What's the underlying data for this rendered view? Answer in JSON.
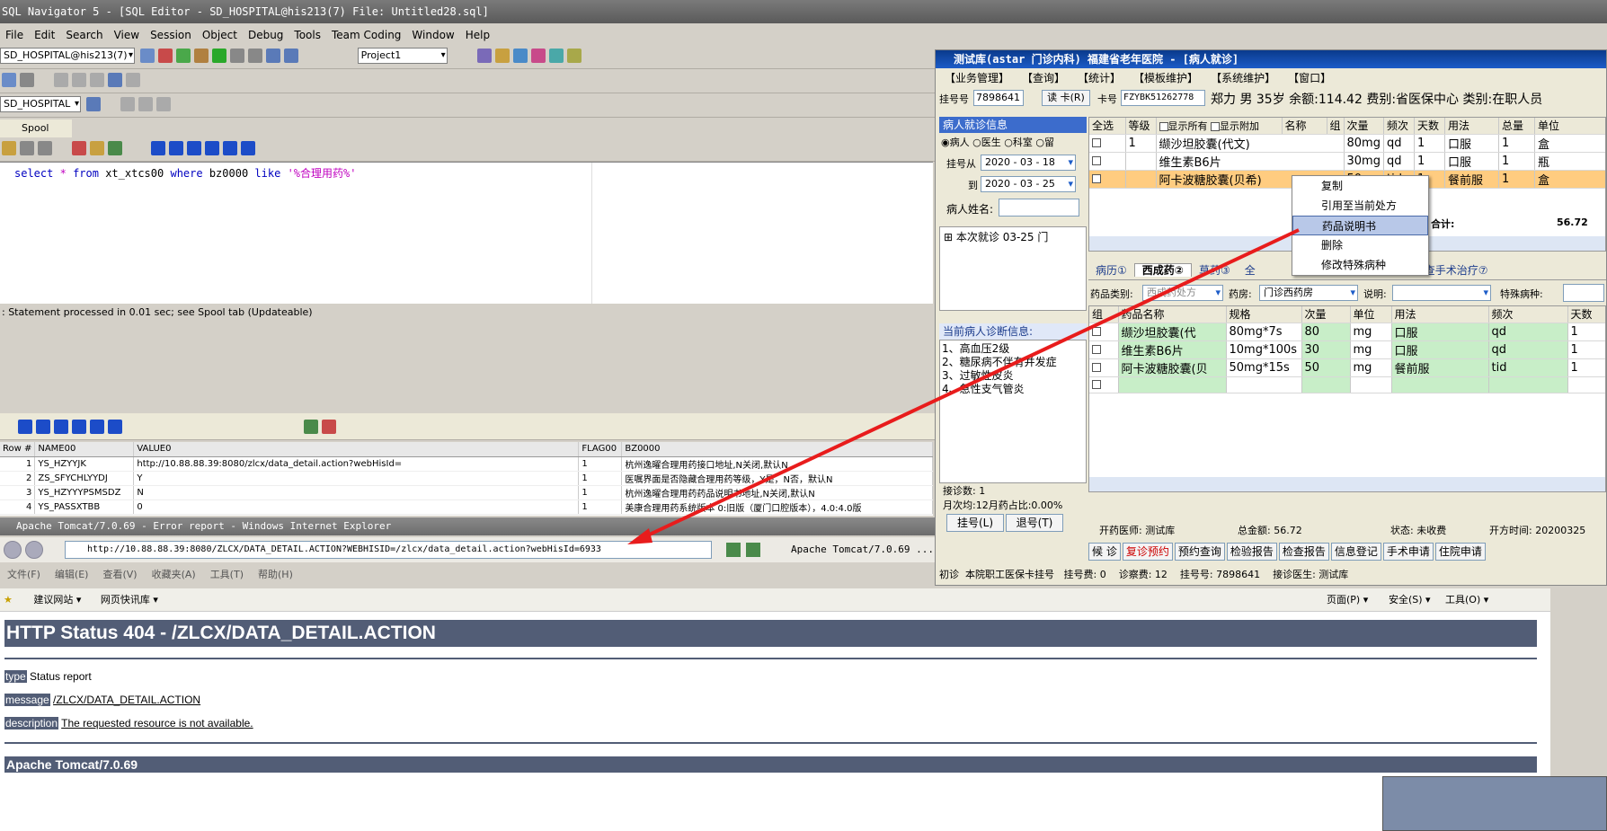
{
  "app": {
    "title": "SQL Navigator 5 - [SQL Editor - SD_HOSPITAL@his213(7) File: Untitled28.sql]"
  },
  "menu": [
    "File",
    "Edit",
    "Search",
    "View",
    "Session",
    "Object",
    "Debug",
    "Tools",
    "Team Coding",
    "Window",
    "Help"
  ],
  "toolbar": {
    "connection": "SD_HOSPITAL@his213(7)",
    "project": "Project1",
    "schema": "SD_HOSPITAL",
    "spool_tab": "Spool"
  },
  "editor": {
    "kw_select": "select",
    "star": "*",
    "kw_from": "from",
    "table": "xt_xtcs00",
    "kw_where": "where",
    "col": "bz0000",
    "kw_like": "like",
    "literal": "'%合理用药%'"
  },
  "status": {
    "text": ": Statement processed in 0.01 sec; see Spool tab (Updateable)"
  },
  "result": {
    "headers": [
      "Row #",
      "NAME00",
      "VALUE0",
      "FLAG00",
      "BZ0000"
    ],
    "rows": [
      [
        "1",
        "YS_HZYYJK",
        "http://10.88.88.39:8080/zlcx/data_detail.action?webHisId=",
        "1",
        "杭州逸曜合理用药接口地址,N关闭,默认N"
      ],
      [
        "2",
        "ZS_SFYCHLYYDJ",
        "Y",
        "1",
        "医嘱界面是否隐藏合理用药等级，Y是，N否，默认N"
      ],
      [
        "3",
        "YS_HZYYYPSMSDZ",
        "N",
        "1",
        "杭州逸曜合理用药药品说明书地址,N关闭,默认N"
      ],
      [
        "4",
        "YS_PASSXTBB",
        "0",
        "1",
        "美康合理用药系统版本 0:旧版（厦门口腔版本），4.0:4.0版"
      ]
    ]
  },
  "ie": {
    "title": "Apache Tomcat/7.0.69 - Error report - Windows Internet Explorer",
    "url": "http://10.88.88.39:8080/ZLCX/DATA_DETAIL.ACTION?WEBHISID=/zlcx/data_detail.action?webHisId=6933",
    "tab": "Apache Tomcat/7.0.69 ...",
    "menu": [
      "文件(F)",
      "编辑(E)",
      "查看(V)",
      "收藏夹(A)",
      "工具(T)",
      "帮助(H)"
    ],
    "fav": [
      "建议网站 ▾",
      "网页快讯库 ▾"
    ],
    "cmds": [
      "页面(P) ▾",
      "安全(S) ▾",
      "工具(O) ▾"
    ]
  },
  "err": {
    "heading": "HTTP Status 404 - /ZLCX/DATA_DETAIL.ACTION",
    "type_label": "type",
    "type_value": "Status report",
    "message_label": "message",
    "message_value": "/ZLCX/DATA_DETAIL.ACTION",
    "desc_label": "description",
    "desc_value": "The requested resource is not available.",
    "footer": "Apache Tomcat/7.0.69"
  },
  "his": {
    "title": "测试库(astar 门诊内科) 福建省老年医院 - [病人就诊]",
    "menu": [
      "【业务管理】",
      "【查询】",
      "【统计】",
      "【模板维护】",
      "【系统维护】",
      "【窗口】"
    ],
    "reg_label": "挂号号",
    "reg_no": "7898641",
    "read_card": "读 卡(R)",
    "card_label": "卡号",
    "card_no": "FZYBK51262778",
    "patient": "郑力 男 35岁 余额:114.42 费别:省医保中心 类别:在职人员",
    "panel_title": "病人就诊信息",
    "radios": [
      "病人",
      "医生",
      "科室",
      "留"
    ],
    "from_label": "挂号从",
    "from_date": "2020 - 03 - 18",
    "to_label": "到",
    "to_date": "2020 - 03 - 25",
    "name_label": "病人姓名:",
    "tree_item": "本次就诊 03-25 门",
    "diag_title": "当前病人诊断信息:",
    "diag": [
      "1、高血压2级",
      "2、糖尿病不伴有并发症",
      "3、过敏性皮炎",
      "4、急性支气管炎"
    ],
    "visits": "接诊数: 1",
    "ratio": "月次均:12月药占比:0.00%",
    "btn_reg": "挂号(L)",
    "btn_ret": "退号(T)",
    "rx_headers": [
      "全选",
      "等级",
      "显示所有",
      "显示附加",
      "名称",
      "组",
      "次量",
      "频次",
      "天数",
      "用法",
      "总量",
      "单位"
    ],
    "rx_rows": [
      [
        "1",
        "缬沙坦胶囊(代文)",
        "80mg",
        "qd",
        "1",
        "口服",
        "1",
        "盒"
      ],
      [
        "",
        "维生素B6片",
        "30mg",
        "qd",
        "1",
        "口服",
        "1",
        "瓶"
      ],
      [
        "",
        "阿卡波糖胶囊(贝希)",
        "50",
        "tid",
        "1",
        "餐前服",
        "1",
        "盒"
      ]
    ],
    "total_label": "合计:",
    "total": "56.72",
    "ctx": [
      "复制",
      "引用至当前处方",
      "药品说明书",
      "删除",
      "修改特殊病种"
    ],
    "tabs": [
      "病历①",
      "西成药②",
      "草药③",
      "全",
      "检查手术治疗⑦"
    ],
    "cat_label": "药品类别:",
    "cat": "西成药处方",
    "pharm_label": "药房:",
    "pharm": "门诊西药房",
    "note_label": "说明:",
    "special_label": "特殊病种:",
    "d_headers": [
      "组",
      "药品名称",
      "规格",
      "次量",
      "单位",
      "用法",
      "频次",
      "天数"
    ],
    "d_rows": [
      [
        "缬沙坦胶囊(代",
        "80mg*7s",
        "80",
        "mg",
        "口服",
        "qd",
        "1"
      ],
      [
        "维生素B6片",
        "10mg*100s",
        "30",
        "mg",
        "口服",
        "qd",
        "1"
      ],
      [
        "阿卡波糖胶囊(贝",
        "50mg*15s",
        "50",
        "mg",
        "餐前服",
        "tid",
        "1"
      ]
    ],
    "doc": "开药医师: 测试库",
    "amount": "总金额: 56.72",
    "state": "状态: 未收费",
    "time": "开方时间: 20200325",
    "actions": [
      "候 诊",
      "复诊预约",
      "预约查询",
      "检验报告",
      "检查报告",
      "信息登记",
      "手术申请",
      "住院申请"
    ],
    "foot": [
      "初诊",
      "本院职工医保卡挂号",
      "挂号费: 0",
      "诊察费: 12",
      "挂号号: 7898641",
      "接诊医生: 测试库"
    ]
  }
}
